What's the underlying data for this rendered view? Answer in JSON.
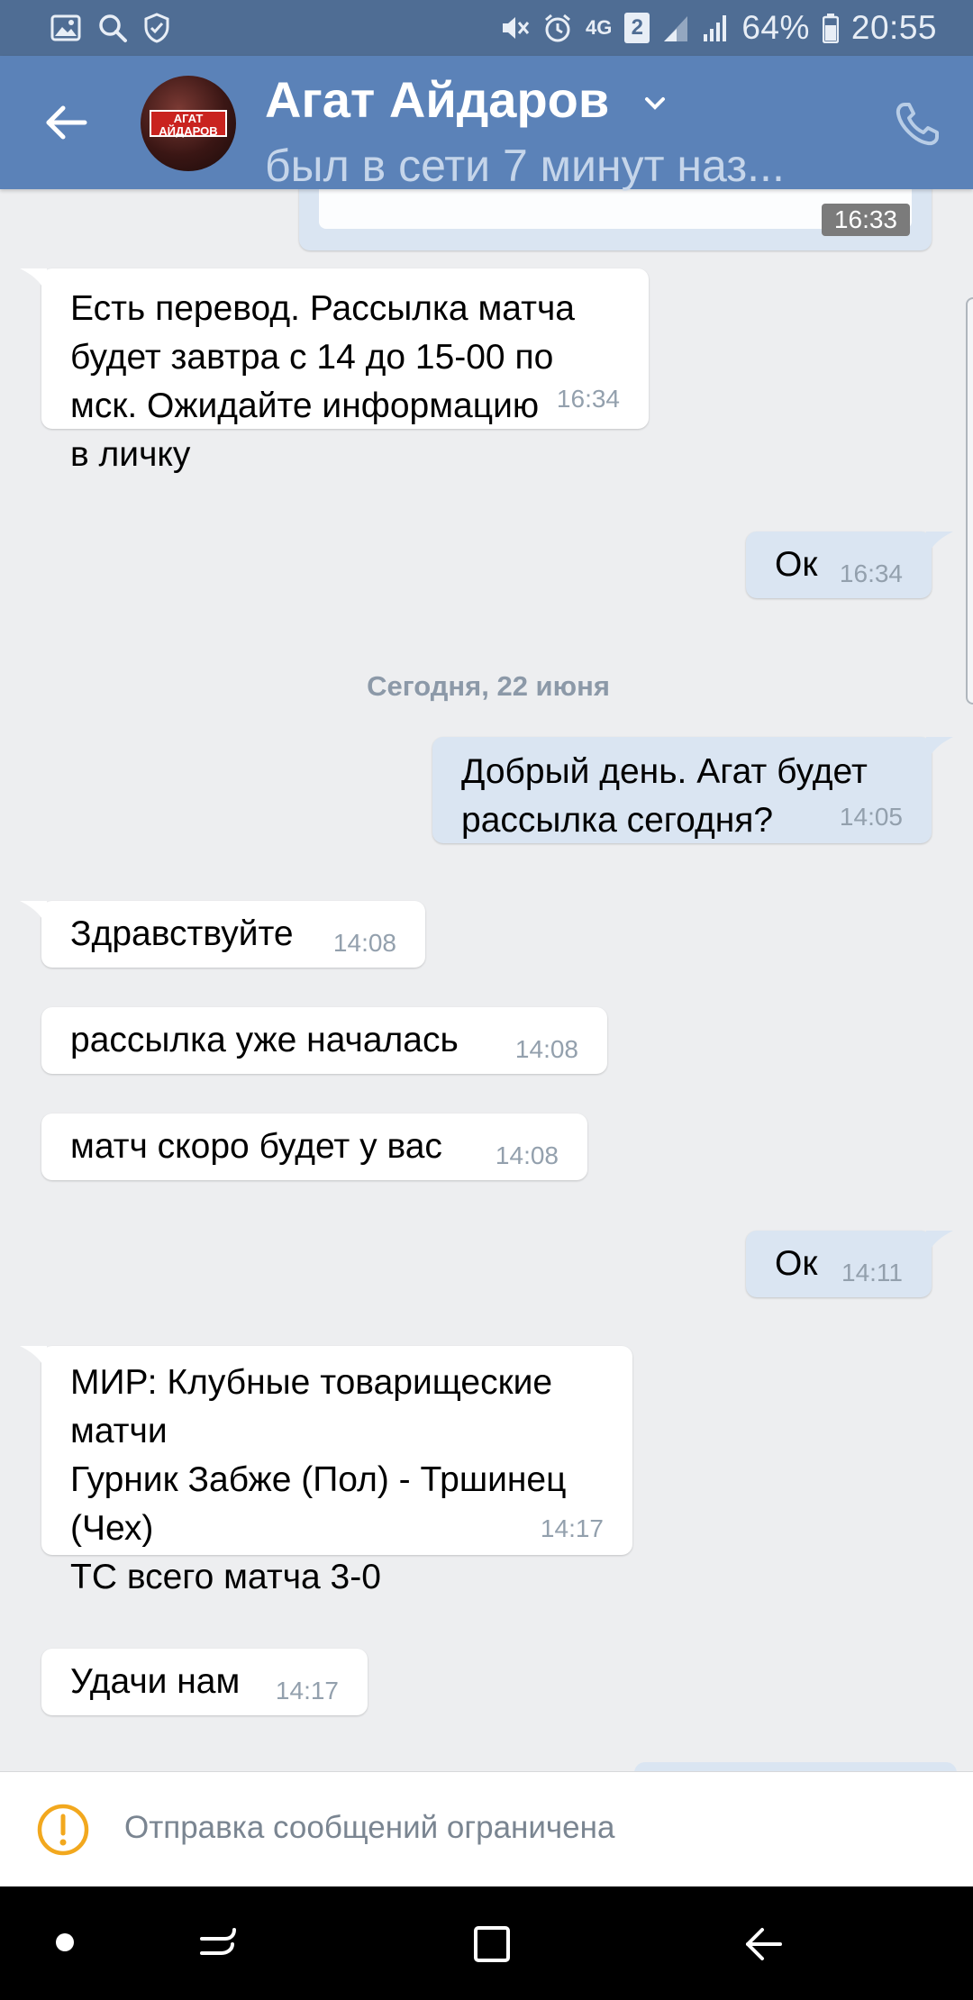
{
  "status_bar": {
    "battery": "64%",
    "time": "20:55",
    "network": "4G",
    "sim_badge": "2",
    "icons": [
      "gallery-icon",
      "search-icon",
      "shield-icon",
      "mute-icon",
      "alarm-icon",
      "network-4g-icon",
      "signal-icon",
      "signal-icon",
      "battery-icon"
    ]
  },
  "header": {
    "contact_name": "Агат Айдаров",
    "status": "был в сети 7 минут наз...",
    "avatar_text": "АГАТ\nАЙДАРОВ",
    "accent_color": "#5b82b8"
  },
  "messages": [
    {
      "direction": "out",
      "partial": true,
      "time": "16:33"
    },
    {
      "direction": "in",
      "text": "Есть перевод. Рассылка матча\nбудет завтра с 14 до 15-00 по\nмск. Ожидайте информацию\nв личку",
      "time": "16:34"
    },
    {
      "direction": "out",
      "text": "Ок",
      "time": "16:34"
    },
    {
      "type": "date",
      "text": "Сегодня, 22 июня"
    },
    {
      "direction": "out",
      "text": "Добрый день. Агат будет\nрассылка сегодня?",
      "time": "14:05"
    },
    {
      "direction": "in",
      "text": "Здравствуйте",
      "time": "14:08"
    },
    {
      "direction": "in",
      "text": "рассылка уже началась",
      "time": "14:08"
    },
    {
      "direction": "in",
      "text": "матч скоро будет у вас",
      "time": "14:08"
    },
    {
      "direction": "out",
      "text": "Ок",
      "time": "14:11"
    },
    {
      "direction": "in",
      "text": "МИР: Клубные товарищеские\nматчи\nГурник Забже (Пол) - Тршинец\n(Чех)\nТС всего матча 3-0",
      "time": "14:17"
    },
    {
      "direction": "in",
      "text": "Удачи нам",
      "time": "14:17"
    }
  ],
  "footer": {
    "restricted_text": "Отправка сообщений ограничена"
  },
  "colors": {
    "incoming_bubble": "#ffffff",
    "outgoing_bubble": "#dae5f2",
    "background": "#edeef0",
    "warning": "#f2a81e"
  }
}
